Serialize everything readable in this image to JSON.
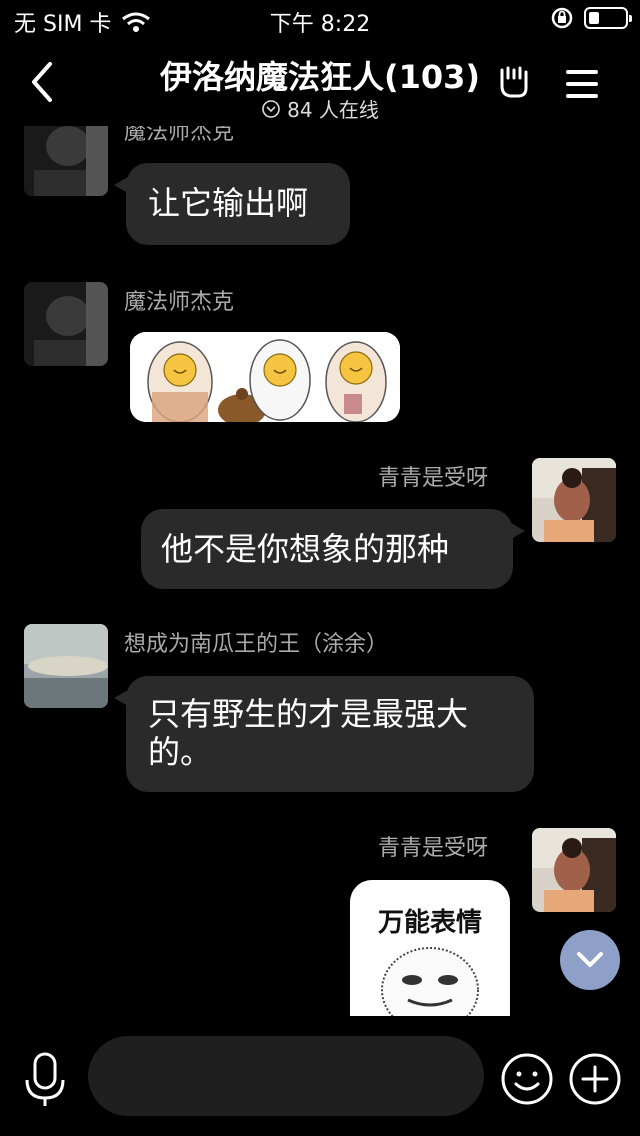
{
  "status_bar": {
    "carrier": "无 SIM 卡",
    "time": "下午 8:22"
  },
  "header": {
    "back_icon": "chevron-left-icon",
    "title": "伊洛纳魔法狂人(103)",
    "online": "84 人在线"
  },
  "messages": [
    {
      "sender": "魔法师杰克",
      "side": "left",
      "type": "text",
      "text": "让它输出啊"
    },
    {
      "sender": "魔法师杰克",
      "side": "left",
      "type": "image"
    },
    {
      "sender": "青青是受呀",
      "side": "right",
      "type": "text",
      "text": "他不是你想象的那种"
    },
    {
      "sender": "想成为南瓜王的王（涂余）",
      "side": "left",
      "type": "text",
      "text": "只有野生的才是最强大的。"
    },
    {
      "sender": "青青是受呀",
      "side": "right",
      "type": "image",
      "caption": "万能表情"
    }
  ],
  "input": {
    "placeholder": ""
  },
  "colors": {
    "background": "#000000",
    "bubble": "#2a2a2a",
    "scroll_button": "#8fa0c8"
  }
}
